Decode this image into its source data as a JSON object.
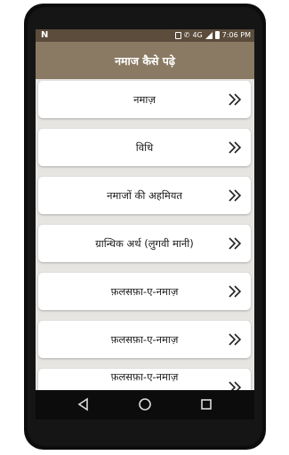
{
  "status_bar": {
    "left_icon": "N",
    "network": "4G",
    "time": "7:06 PM",
    "icons": [
      "vibrate-icon",
      "call-icon",
      "signal-icon",
      "battery-icon"
    ]
  },
  "app_bar": {
    "title": "नमाज कैसे पढ़े"
  },
  "menu": {
    "items": [
      {
        "label": "नमाज़"
      },
      {
        "label": "विधि"
      },
      {
        "label": "नमाजों की अहमियत"
      },
      {
        "label": "ग्रान्धिक अर्थ (लुगवी मानी)"
      },
      {
        "label": "फ़लसफ़ा-ए-नमाज़"
      },
      {
        "label": "फ़लसफ़ा-ए-नमाज़"
      },
      {
        "label": "फ़लसफ़ा-ए-नमाज़"
      }
    ]
  },
  "colors": {
    "status_bar": "#5b4c3b",
    "app_bar": "#8a7a63",
    "screen_bg": "#e7e5e2",
    "card_bg": "#ffffff"
  },
  "nav_bar": {
    "buttons": [
      "back-icon",
      "home-icon",
      "recents-icon"
    ]
  }
}
